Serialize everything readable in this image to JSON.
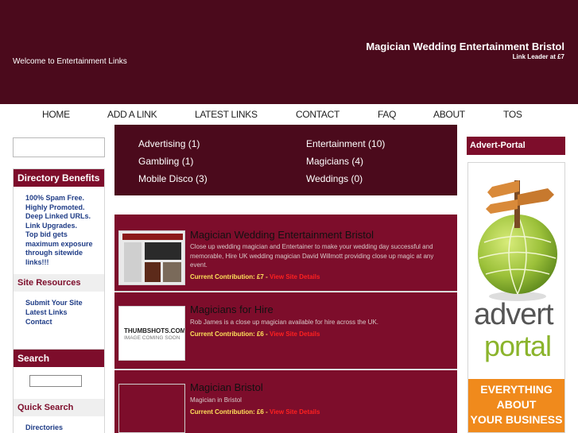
{
  "header": {
    "welcome": "Welcome to Entertainment Links",
    "site_title": "Magician Wedding Entertainment Bristol",
    "tagline": "Link Leader at £7"
  },
  "nav": {
    "home": "HOME",
    "add_link": "ADD A LINK",
    "latest_links": "LATEST LINKS",
    "contact": "CONTACT",
    "faq": "FAQ",
    "about": "ABOUT",
    "tos": "TOS"
  },
  "sidebar": {
    "benefits_heading": "Directory Benefits",
    "benefits": [
      "100% Spam Free.",
      "Highly Promoted.",
      "Deep Linked URLs.",
      "Link Upgrades.",
      "Top bid gets",
      "maximum exposure",
      "through sitewide",
      "links!!!"
    ],
    "resources_heading": "Site Resources",
    "resources": [
      "Submit Your Site",
      "Latest Links",
      "Contact"
    ],
    "search_heading": "Search",
    "quick_search_heading": "Quick Search",
    "quick_links": [
      "Directories"
    ]
  },
  "categories": [
    {
      "name": "Advertising (1)"
    },
    {
      "name": "Entertainment (10)"
    },
    {
      "name": "Gambling (1)"
    },
    {
      "name": "Magicians (4)"
    },
    {
      "name": "Mobile Disco (3)"
    },
    {
      "name": "Weddings (0)"
    }
  ],
  "listings": [
    {
      "title": "Magician Wedding Entertainment Bristol",
      "description": "Close up wedding magician and Entertainer to make your wedding day successful and memorable, Hire UK wedding magician David Willmott providing close up magic at any event.",
      "contribution": "Current Contribution: £7 -",
      "details": "View Site Details"
    },
    {
      "title": "Magicians for Hire",
      "description": "Rob James is a close up magician available for hire across the UK.",
      "contribution": "Current Contribution: £6 -",
      "details": "View Site Details",
      "thumb_line1": "THUMBSHOTS.COM",
      "thumb_line2": "IMAGE COMING SOON"
    },
    {
      "title": "Magician Bristol",
      "description": "Magician in Bristol",
      "contribution": "Current Contribution: £6 -",
      "details": "View Site Details"
    }
  ],
  "advert": {
    "heading": "Advert-Portal",
    "brand_line1": "advert",
    "brand_line2": "portal",
    "banner_lines": [
      "EVERYTHING",
      "ABOUT",
      "YOUR BUSINESS"
    ]
  },
  "colors": {
    "header_bg": "#4b0a1c",
    "accent": "#7d0d2b",
    "contribution": "#ffe15a",
    "details_link": "#ff2020"
  }
}
